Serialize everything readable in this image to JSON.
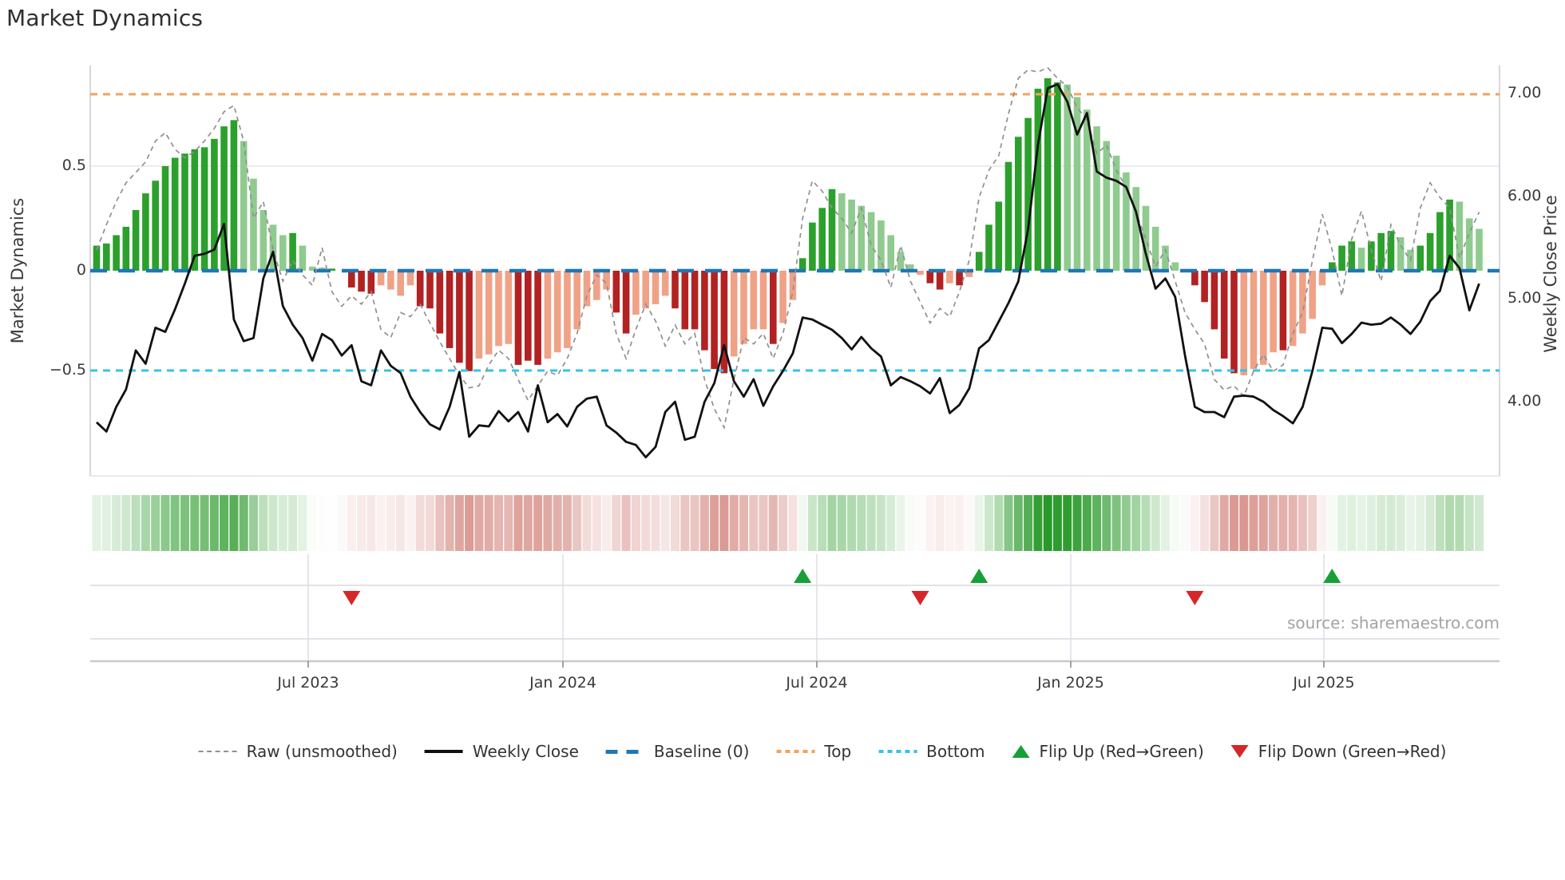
{
  "title": "Market Dynamics",
  "source": "source: sharemaestro.com",
  "axes": {
    "left_label": "Market Dynamics",
    "right_label": "Weekly Close Price",
    "left_ticks": [
      "0.5",
      "0",
      "−0.5"
    ],
    "right_ticks": [
      "7.00",
      "6.00",
      "5.00",
      "4.00"
    ],
    "x_ticks": [
      "Jul 2023",
      "Jan 2024",
      "Jul 2024",
      "Jan 2025",
      "Jul 2025"
    ]
  },
  "legend": {
    "items": [
      {
        "label": "Raw (unsmoothed)"
      },
      {
        "label": "Weekly Close"
      },
      {
        "label": "Baseline (0)"
      },
      {
        "label": "Top"
      },
      {
        "label": "Bottom"
      },
      {
        "label": "Flip Up (Red→Green)"
      },
      {
        "label": "Flip Down (Green→Red)"
      }
    ]
  },
  "colors": {
    "strong_green": "#2ca02c",
    "light_green": "#8fcb8f",
    "strong_red": "#b22222",
    "light_red": "#f0a287",
    "baseline_blue": "#1f77b4",
    "top_orange": "#f2a25c",
    "bottom_cyan": "#35c3e8",
    "price_black": "#111111",
    "raw_gray": "#909090",
    "flip_up_green": "#18a038",
    "flip_down_red": "#d62728",
    "grid": "#e6e6ee"
  },
  "chart_data": {
    "type": "combo: weekly bar oscillator + dashed raw line (left axis) + price line (right axis) + heatmap strip + flip markers",
    "x_tick_labels": [
      "Jul 2023",
      "Jan 2024",
      "Jul 2024",
      "Jan 2025",
      "Jul 2025"
    ],
    "left_axis": {
      "label": "Market Dynamics",
      "ticks": [
        0.5,
        0,
        -0.5
      ],
      "range": [
        -0.98,
        0.98
      ]
    },
    "right_axis": {
      "label": "Weekly Close Price",
      "ticks": [
        7.0,
        6.0,
        5.0,
        4.0
      ],
      "range": [
        3.28,
        7.27
      ]
    },
    "baseline": 0,
    "top_band": 0.85,
    "bottom_band": -0.48,
    "n_weeks": 142,
    "series": {
      "momentum": {
        "name": "Momentum bars",
        "values": [
          0.12,
          0.13,
          0.17,
          0.21,
          0.29,
          0.37,
          0.43,
          0.5,
          0.54,
          0.56,
          0.58,
          0.59,
          0.63,
          0.69,
          0.72,
          0.62,
          0.44,
          0.29,
          0.22,
          0.17,
          0.18,
          0.12,
          0.02,
          0.015,
          0.01,
          0,
          -0.08,
          -0.1,
          -0.11,
          -0.07,
          -0.09,
          -0.12,
          -0.07,
          -0.17,
          -0.18,
          -0.3,
          -0.37,
          -0.44,
          -0.48,
          -0.42,
          -0.4,
          -0.36,
          -0.35,
          -0.45,
          -0.43,
          -0.45,
          -0.42,
          -0.39,
          -0.37,
          -0.28,
          -0.17,
          -0.14,
          -0.09,
          -0.2,
          -0.3,
          -0.21,
          -0.18,
          -0.16,
          -0.12,
          -0.18,
          -0.28,
          -0.28,
          -0.38,
          -0.47,
          -0.49,
          -0.41,
          -0.35,
          -0.28,
          -0.28,
          -0.35,
          -0.25,
          -0.14,
          0.06,
          0.23,
          0.3,
          0.39,
          0.37,
          0.34,
          0.31,
          0.28,
          0.24,
          0.17,
          0.09,
          0.03,
          -0.02,
          -0.06,
          -0.09,
          -0.06,
          -0.07,
          -0.03,
          0.09,
          0.22,
          0.33,
          0.52,
          0.64,
          0.73,
          0.87,
          0.92,
          0.9,
          0.89,
          0.83,
          0.77,
          0.69,
          0.62,
          0.55,
          0.47,
          0.4,
          0.31,
          0.21,
          0.12,
          0.04,
          0,
          -0.07,
          -0.15,
          -0.28,
          -0.42,
          -0.49,
          -0.5,
          -0.47,
          -0.45,
          -0.39,
          -0.38,
          -0.36,
          -0.3,
          -0.23,
          -0.07,
          0.04,
          0.12,
          0.14,
          0.11,
          0.14,
          0.18,
          0.19,
          0.16,
          0.1,
          0.12,
          0.18,
          0.28,
          0.34,
          0.33,
          0.25,
          0.2
        ],
        "shades": "GGGGGGGGGGGGGGGgggggGgggGnRRRrrrrRRRRRRrrrrRRRrrrrrrrRRrrrrRRRRRRrrrrRrrGGGGggggggggrRRrRrGGGGGGGGGggggggggggggnRRRRRrrrrRrrrrGGGgGGGggGGGGggg"
      },
      "raw": {
        "name": "Raw (unsmoothed)",
        "values": [
          0.1,
          0.22,
          0.33,
          0.42,
          0.47,
          0.52,
          0.62,
          0.66,
          0.58,
          0.54,
          0.57,
          0.62,
          0.68,
          0.76,
          0.79,
          0.62,
          0.25,
          0.33,
          0.1,
          -0.05,
          0.05,
          -0.02,
          -0.07,
          0.11,
          -0.1,
          -0.17,
          -0.12,
          -0.16,
          -0.1,
          -0.28,
          -0.32,
          -0.2,
          -0.22,
          -0.16,
          -0.25,
          -0.34,
          -0.42,
          -0.5,
          -0.56,
          -0.55,
          -0.45,
          -0.38,
          -0.42,
          -0.52,
          -0.62,
          -0.55,
          -0.48,
          -0.5,
          -0.42,
          -0.3,
          -0.12,
          -0.02,
          -0.06,
          -0.3,
          -0.42,
          -0.28,
          -0.16,
          -0.24,
          -0.36,
          -0.26,
          -0.35,
          -0.3,
          -0.52,
          -0.66,
          -0.75,
          -0.52,
          -0.32,
          -0.35,
          -0.3,
          -0.42,
          -0.3,
          -0.1,
          0.25,
          0.43,
          0.38,
          0.3,
          0.25,
          0.18,
          0.3,
          0.12,
          0.05,
          -0.08,
          0.12,
          -0.05,
          -0.15,
          -0.25,
          -0.18,
          -0.22,
          -0.1,
          0.05,
          0.35,
          0.48,
          0.55,
          0.75,
          0.92,
          0.96,
          0.95,
          0.97,
          0.92,
          0.88,
          0.78,
          0.72,
          0.56,
          0.6,
          0.48,
          0.4,
          0.28,
          0.15,
          0.02,
          0.1,
          -0.05,
          -0.2,
          -0.28,
          -0.35,
          -0.52,
          -0.57,
          -0.55,
          -0.6,
          -0.48,
          -0.4,
          -0.48,
          -0.45,
          -0.3,
          -0.2,
          0.05,
          0.27,
          0.1,
          -0.12,
          0.15,
          0.285,
          0.1,
          -0.05,
          0.22,
          0.12,
          0.05,
          0.3,
          0.42,
          0.35,
          0.3,
          0.06,
          0.18,
          0.28
        ]
      },
      "price": {
        "name": "Weekly Close",
        "values": [
          3.8,
          3.71,
          3.95,
          4.12,
          4.5,
          4.37,
          4.72,
          4.68,
          4.9,
          5.15,
          5.42,
          5.44,
          5.48,
          5.73,
          4.8,
          4.59,
          4.62,
          5.2,
          5.46,
          4.93,
          4.75,
          4.62,
          4.4,
          4.66,
          4.6,
          4.45,
          4.55,
          4.2,
          4.16,
          4.5,
          4.35,
          4.28,
          4.05,
          3.9,
          3.78,
          3.73,
          3.95,
          4.29,
          3.66,
          3.77,
          3.76,
          3.91,
          3.81,
          3.9,
          3.71,
          4.16,
          3.8,
          3.88,
          3.76,
          3.95,
          4.03,
          4.05,
          3.77,
          3.7,
          3.61,
          3.58,
          3.46,
          3.56,
          3.9,
          4.0,
          3.63,
          3.66,
          4.0,
          4.18,
          4.55,
          4.2,
          4.05,
          4.22,
          3.96,
          4.15,
          4.3,
          4.47,
          4.82,
          4.8,
          4.75,
          4.7,
          4.62,
          4.51,
          4.63,
          4.52,
          4.44,
          4.16,
          4.24,
          4.2,
          4.15,
          4.08,
          4.23,
          3.89,
          3.97,
          4.13,
          4.52,
          4.6,
          4.78,
          4.96,
          5.17,
          5.68,
          6.5,
          7.05,
          7.09,
          6.92,
          6.6,
          6.81,
          6.24,
          6.18,
          6.15,
          6.09,
          5.85,
          5.44,
          5.1,
          5.2,
          5.02,
          4.45,
          3.95,
          3.9,
          3.9,
          3.85,
          4.05,
          4.06,
          4.05,
          4.0,
          3.92,
          3.86,
          3.79,
          3.95,
          4.3,
          4.72,
          4.71,
          4.57,
          4.66,
          4.77,
          4.75,
          4.76,
          4.82,
          4.75,
          4.66,
          4.78,
          4.98,
          5.08,
          5.42,
          5.3,
          4.89,
          5.15
        ]
      }
    },
    "heatmap": {
      "derived_from": "momentum",
      "note": "strip cells colored by sign and |value| of momentum"
    },
    "flip_up_indices": [
      73,
      91,
      127
    ],
    "flip_down_indices": [
      27,
      85,
      113
    ]
  }
}
